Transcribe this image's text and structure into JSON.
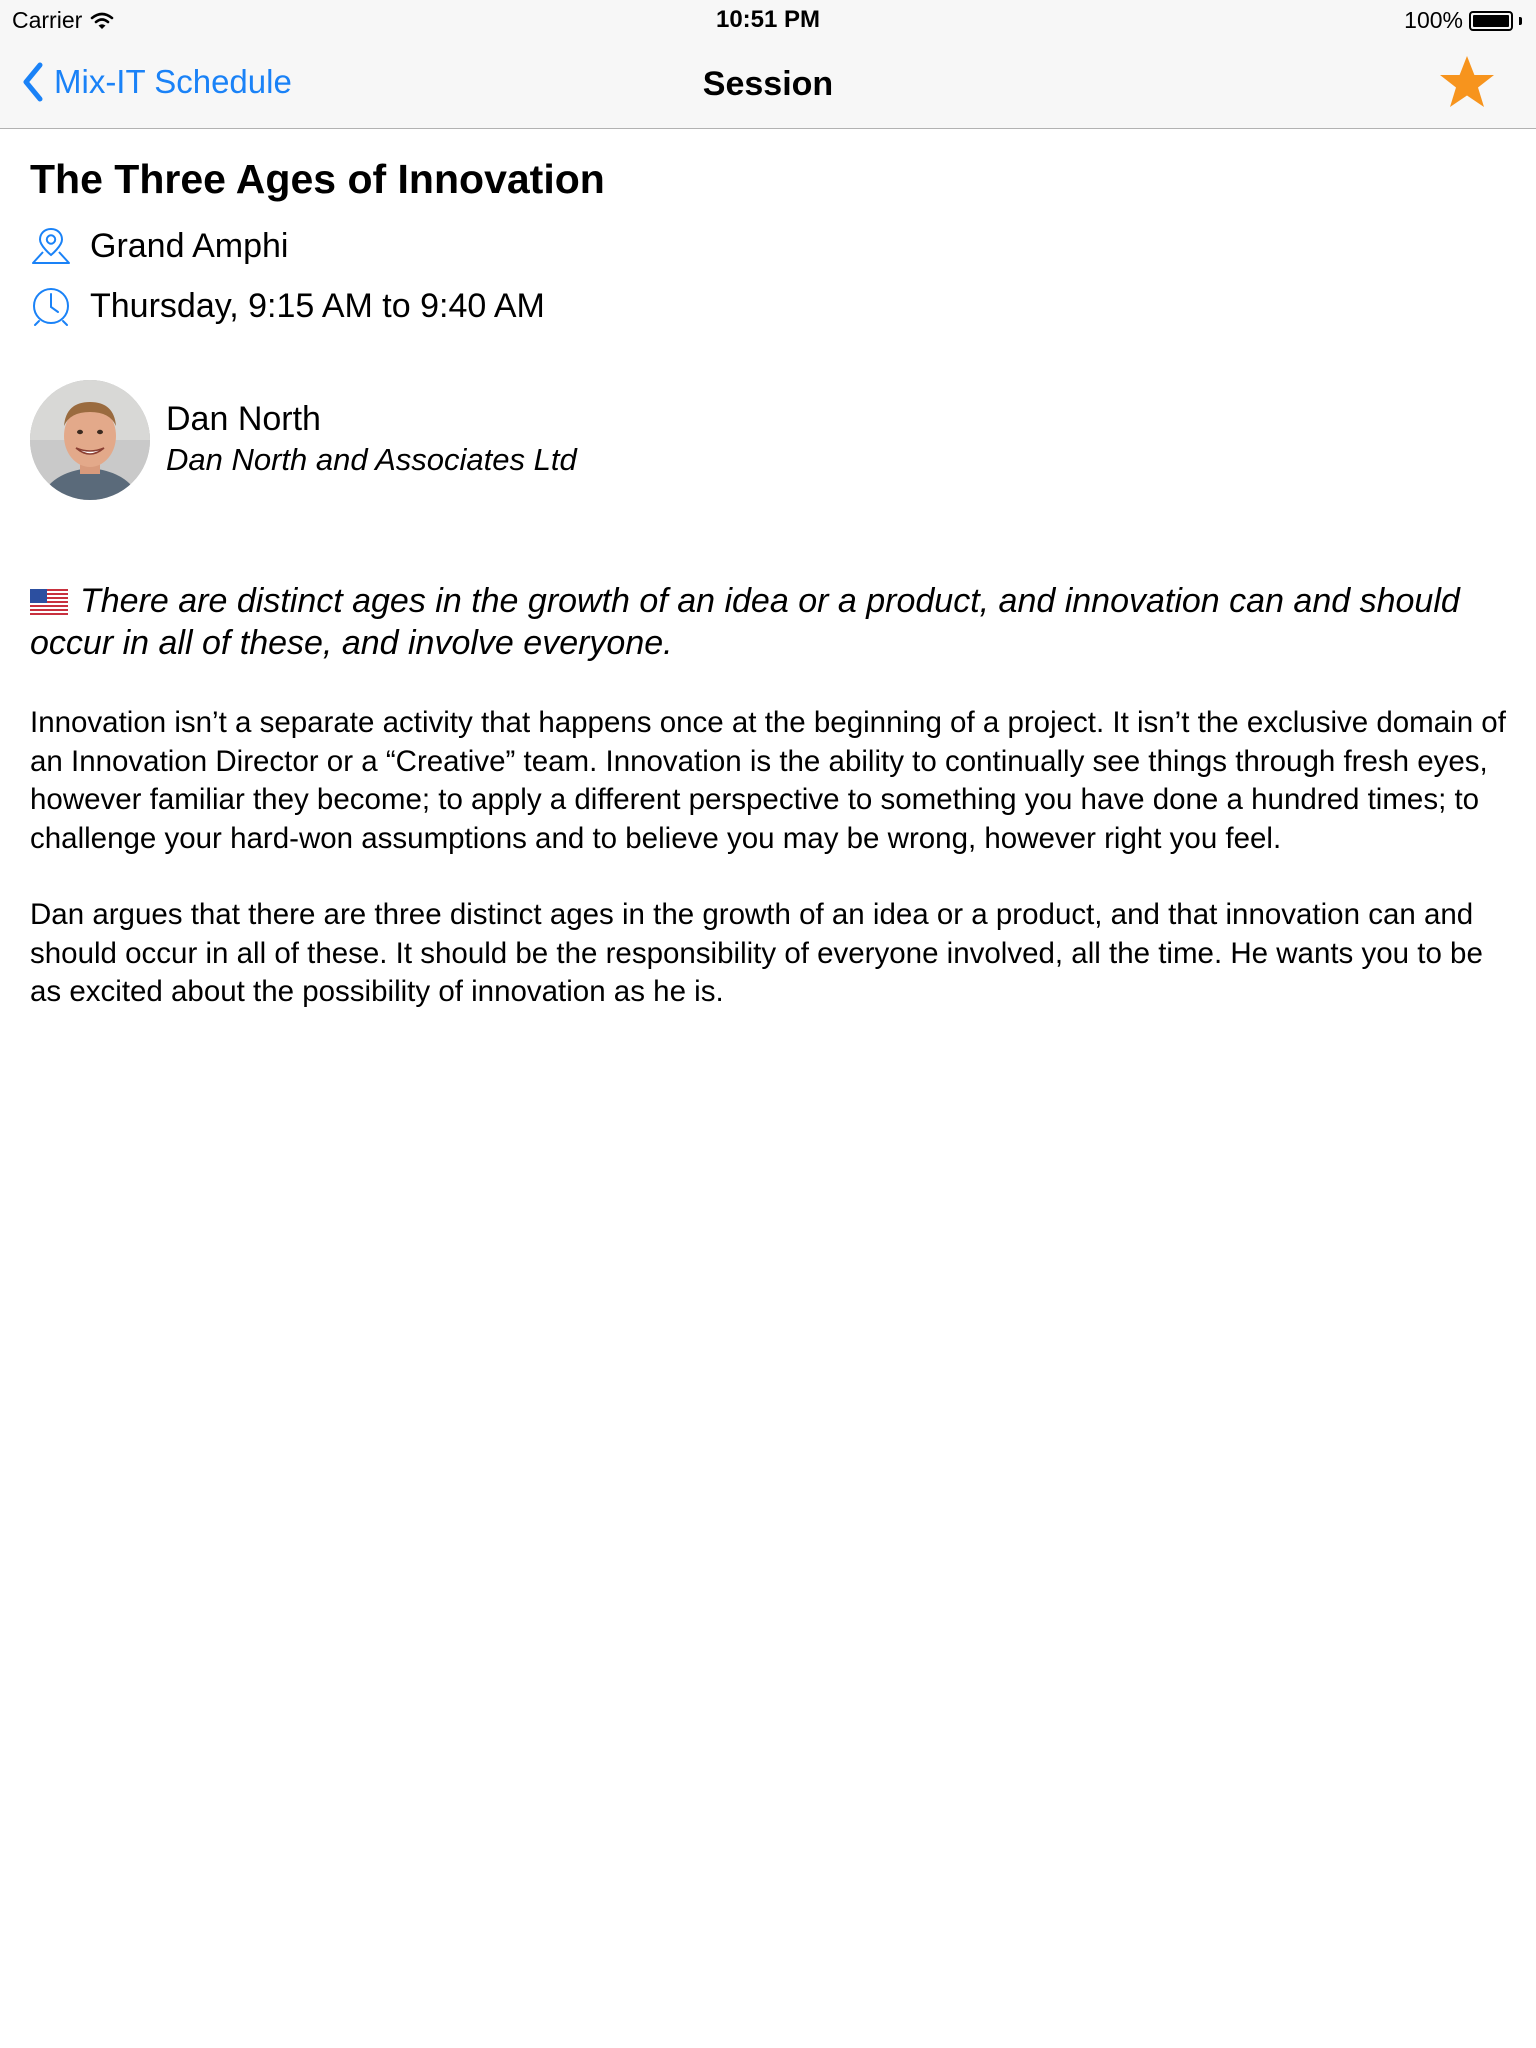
{
  "status_bar": {
    "carrier": "Carrier",
    "time": "10:51 PM",
    "battery": "100%"
  },
  "nav": {
    "back_label": "Mix-IT Schedule",
    "title": "Session",
    "favorite_icon": "star-icon",
    "favorite_color": "#f7941d",
    "accent_color": "#1a82f7"
  },
  "session": {
    "title": "The Three Ages of Innovation",
    "room": "Grand Amphi",
    "time": "Thursday, 9:15 AM to 9:40 AM",
    "speaker": {
      "name": "Dan North",
      "company": "Dan North and Associates Ltd"
    },
    "language_icon": "us-flag-icon",
    "summary": "There are distinct ages in the growth of an idea or a product, and innovation can and should occur in all of these, and involve everyone.",
    "description": [
      "Innovation isn’t a separate activity that happens once at the beginning of a project. It isn’t the exclusive domain of an Innovation Director or a “Creative” team. Innovation is the ability to continually see things through fresh eyes, however familiar they become; to apply a different perspective to something you have done a hundred times; to challenge your hard-won assumptions and to believe you may be wrong, however right you feel.",
      "Dan argues that there are three distinct ages in the growth of an idea or a product, and that innovation can and should occur in all of these. It should be the responsibility of everyone involved, all the time. He wants you to be as excited about the possibility of innovation as he is."
    ]
  }
}
